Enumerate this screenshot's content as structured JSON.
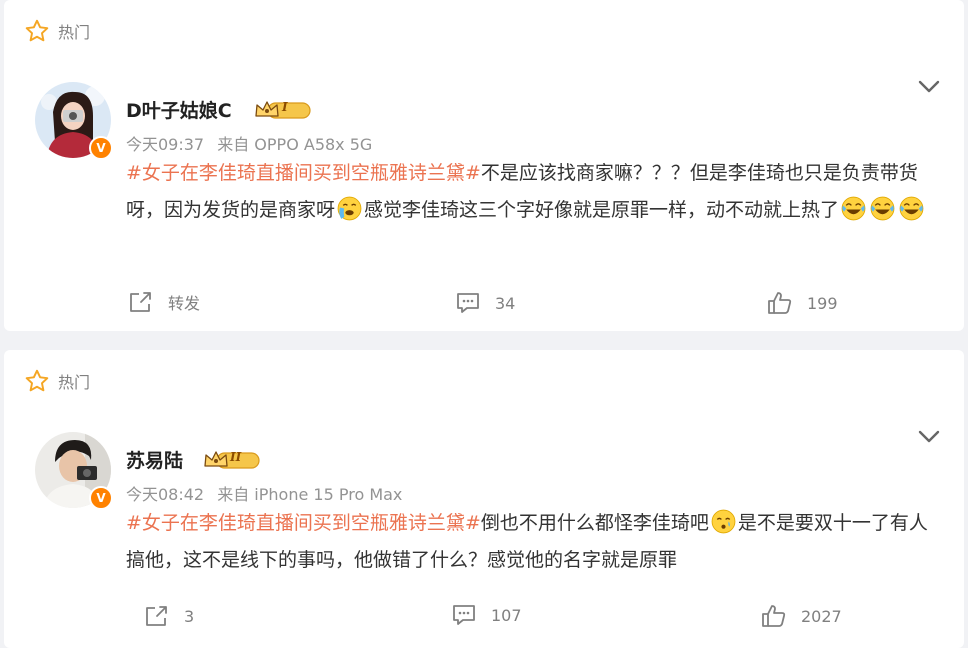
{
  "posts": [
    {
      "hot_label": "热门",
      "username": "D叶子姑娘C",
      "level": "I",
      "time": "今天09:37",
      "source": "来自 OPPO A58x 5G",
      "hashtag": "#女子在李佳琦直播间买到空瓶雅诗兰黛#",
      "text_1": "不是应该找商家嘛？？？但是李佳琦也只是负责带货呀，因为发货的是商家呀",
      "text_2": "感觉李佳琦这三个字好像就是原罪一样，动不动就上热了",
      "repost_label": "转发",
      "comments": "34",
      "likes": "199"
    },
    {
      "hot_label": "热门",
      "username": "苏易陆",
      "level": "II",
      "time": "今天08:42",
      "source": "来自 iPhone 15 Pro Max",
      "hashtag": "#女子在李佳琦直播间买到空瓶雅诗兰黛#",
      "text_1": "倒也不用什么都怪李佳琦吧",
      "text_2": "是不是要双十一了有人搞他，这不是线下的事吗，他做错了什么？感觉他的名字就是原罪",
      "reposts": "3",
      "comments": "107",
      "likes": "2027"
    }
  ],
  "verified_badge": "V",
  "colors": {
    "hashtag": "#eb7350",
    "badge": "#ff8200",
    "crown": "#f5a623"
  }
}
